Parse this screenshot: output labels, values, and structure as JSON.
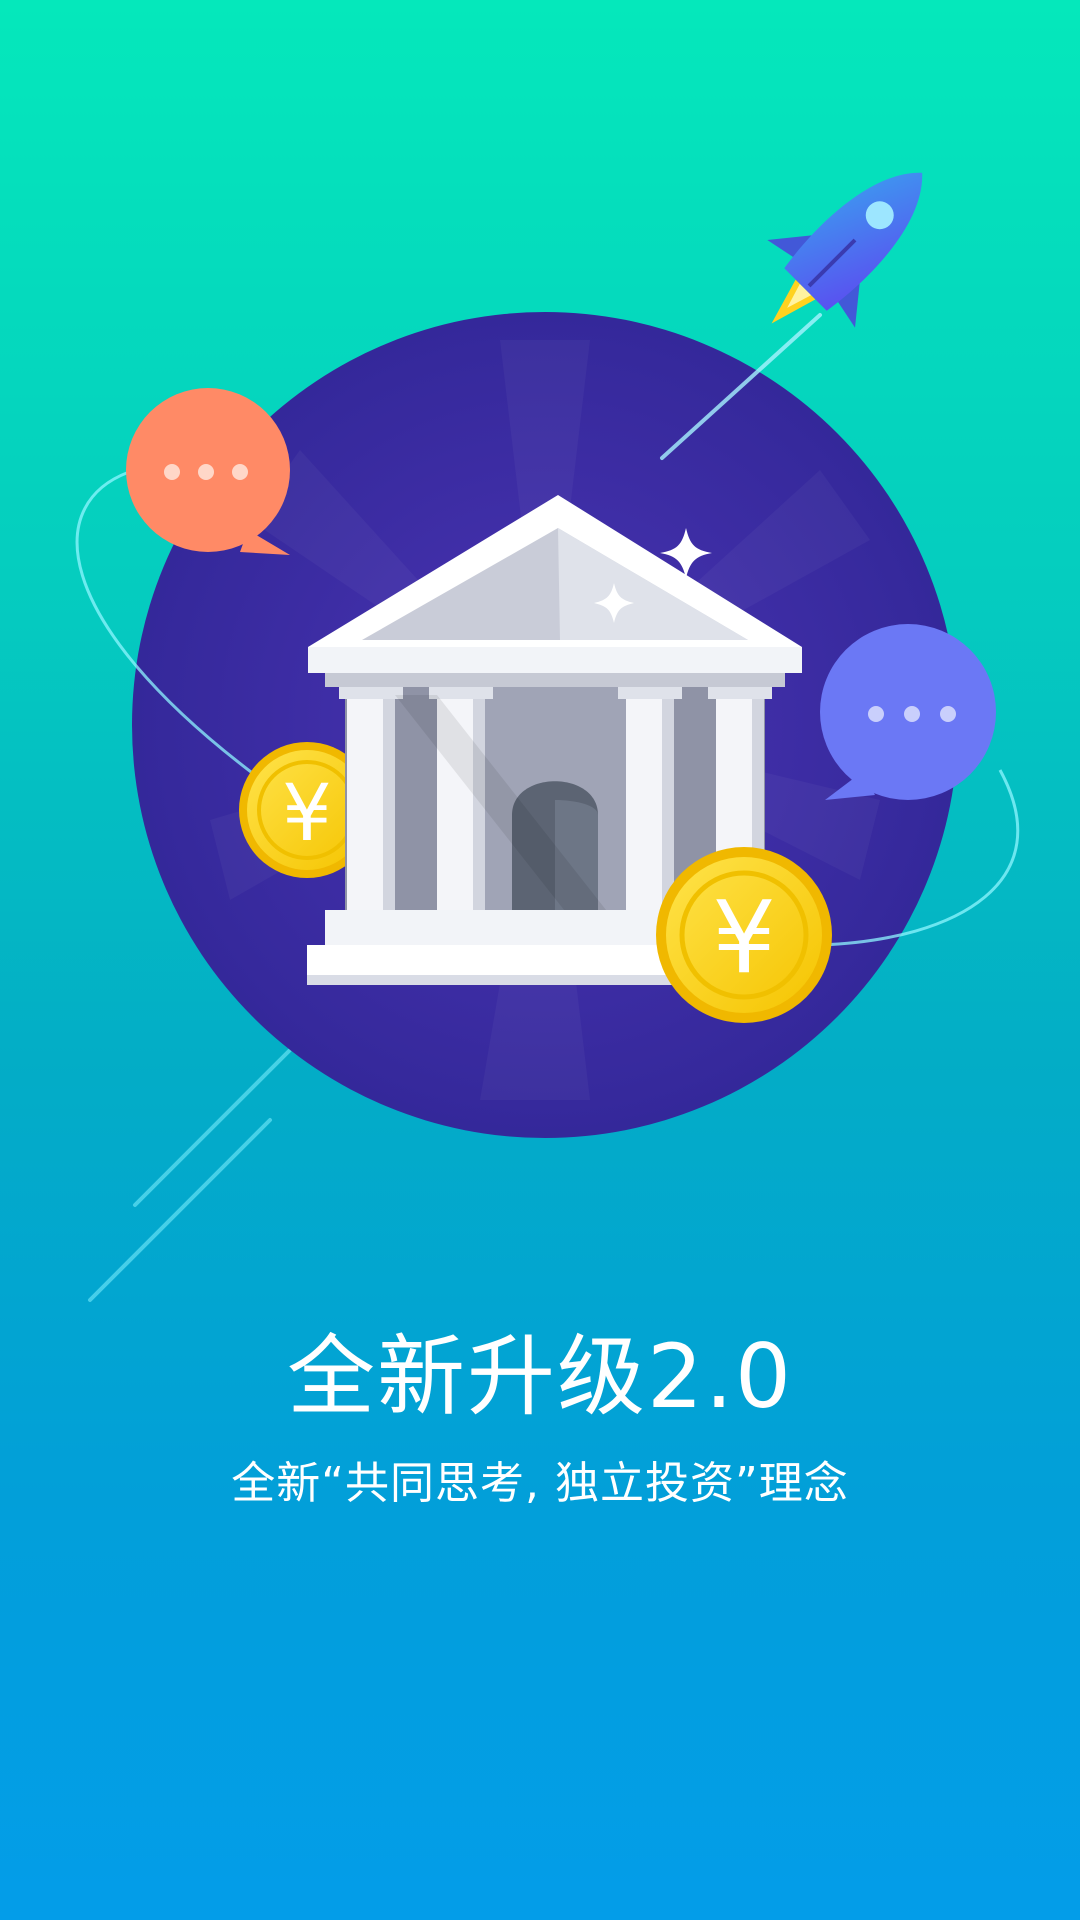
{
  "splash": {
    "headline": "全新升级2.0",
    "subtitle": "全新“共同思考, 独立投资”理念"
  },
  "illustration": {
    "icons": [
      "bank-icon",
      "yuan-coin-icon",
      "yuan-coin-icon",
      "speech-bubble-icon",
      "speech-bubble-icon",
      "rocket-icon",
      "sparkle-icon"
    ],
    "coin_glyph": "¥",
    "colors": {
      "circle": "#3b2aa0",
      "orange_bubble": "#ff8a66",
      "blue_bubble": "#6b78f5",
      "coin": "#ffd21f",
      "building": "#f2f4f8",
      "rocket": "#4f66f0"
    }
  }
}
